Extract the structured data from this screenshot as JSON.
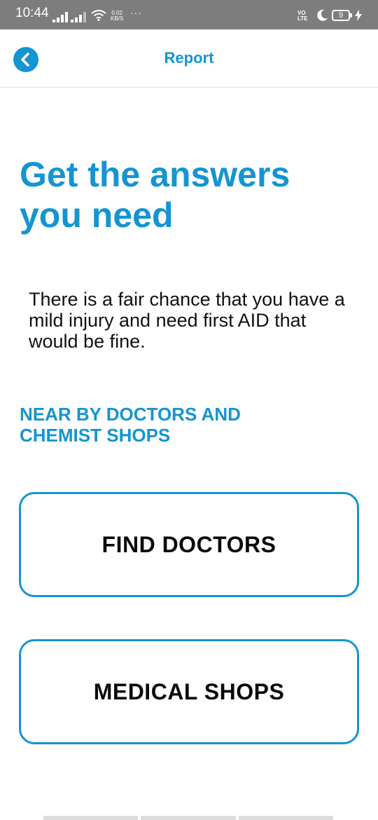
{
  "status_bar": {
    "time": "10:44",
    "net_speed_value": "0.02",
    "net_speed_unit": "KB/S",
    "more": "···",
    "volte_top": "VO",
    "volte_bottom": "LTE",
    "battery_level": "9"
  },
  "header": {
    "title": "Report",
    "back_icon": "chevron-left-icon"
  },
  "main": {
    "headline": "Get the answers you need",
    "message": "There is a fair chance that you have a mild injury and need first AID that would be fine.",
    "section_label": "NEAR BY DOCTORS AND CHEMIST SHOPS",
    "buttons": [
      {
        "label": "FIND DOCTORS"
      },
      {
        "label": "MEDICAL SHOPS"
      }
    ]
  },
  "colors": {
    "accent": "#1495d1",
    "status_bar": "#7d7d7d",
    "text": "#111111"
  }
}
